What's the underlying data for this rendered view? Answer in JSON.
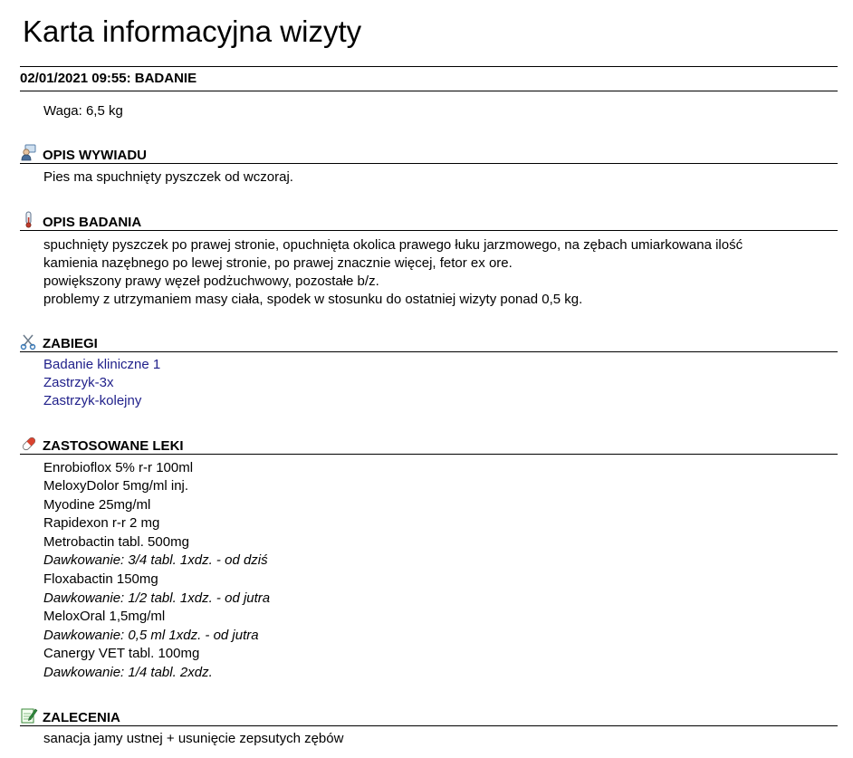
{
  "title": "Karta informacyjna wizyty",
  "visit_header": "02/01/2021 09:55: BADANIE",
  "weight_line": "Waga: 6,5 kg",
  "sections": {
    "interview": {
      "heading": "OPIS WYWIADU",
      "icon": "person-icon",
      "lines": [
        "Pies ma spuchnięty pyszczek od wczoraj."
      ]
    },
    "examination": {
      "heading": "OPIS BADANIA",
      "icon": "thermometer-icon",
      "lines": [
        "spuchnięty pyszczek po prawej stronie, opuchnięta okolica prawego łuku jarzmowego, na zębach umiarkowana ilość",
        "kamienia nazębnego po lewej stronie, po prawej znacznie więcej, fetor ex ore.",
        "powiększony prawy węzeł podżuchwowy, pozostałe b/z.",
        "problemy z utrzymaniem masy ciała, spodek w stosunku do ostatniej wizyty ponad 0,5 kg."
      ]
    },
    "procedures": {
      "heading": "ZABIEGI",
      "icon": "scissors-icon",
      "items": [
        "Badanie kliniczne 1",
        "Zastrzyk-3x",
        "Zastrzyk-kolejny"
      ]
    },
    "drugs": {
      "heading": "ZASTOSOWANE LEKI",
      "icon": "pill-icon",
      "items": [
        "Enrobioflox 5% r-r 100ml",
        "MeloxyDolor 5mg/ml inj.",
        "Myodine 25mg/ml",
        "Rapidexon r-r 2 mg",
        "Metrobactin tabl. 500mg",
        "Dawkowanie: 3/4 tabl. 1xdz. - od dziś",
        "Floxabactin 150mg",
        "Dawkowanie: 1/2 tabl. 1xdz. - od jutra",
        "MeloxOral 1,5mg/ml",
        "Dawkowanie: 0,5 ml 1xdz. - od jutra",
        "Canergy VET tabl. 100mg",
        "Dawkowanie: 1/4 tabl. 2xdz."
      ]
    },
    "recommendations": {
      "heading": "ZALECENIA",
      "icon": "note-pencil-icon",
      "lines": [
        "sanacja jamy ustnej + usunięcie zepsutych zębów"
      ]
    }
  },
  "colors": {
    "link": "#1f1f8a",
    "text": "#000000"
  }
}
